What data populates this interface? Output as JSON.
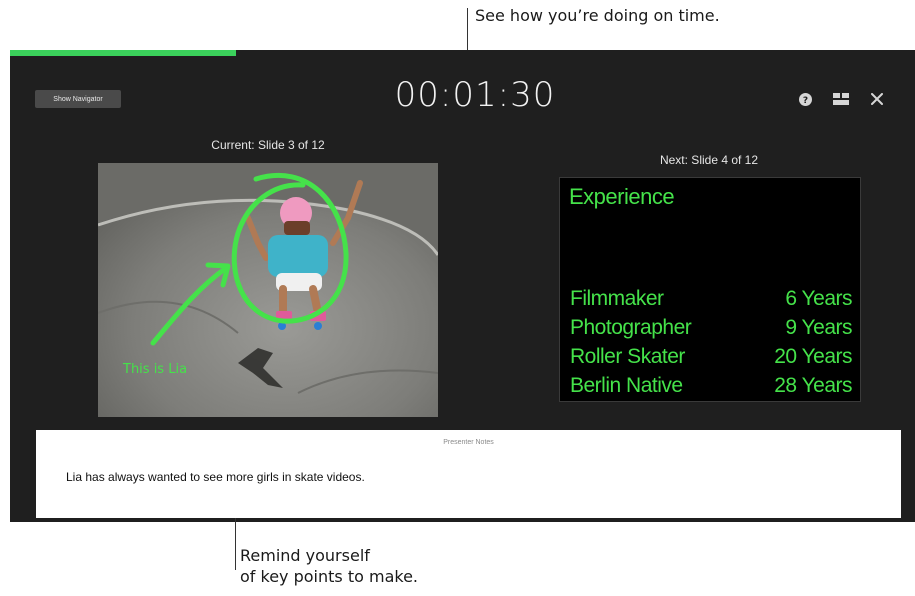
{
  "callouts": {
    "timer_tip": "See how you’re doing on time.",
    "notes_tip_line1": "Remind yourself",
    "notes_tip_line2": "of key points to make."
  },
  "toolbar": {
    "show_navigator_label": "Show Navigator",
    "elapsed_time": "00:01:30",
    "progress_fraction": 0.25,
    "icons": [
      "help-icon",
      "layout-icon",
      "close-icon"
    ]
  },
  "current": {
    "label": "Current: Slide 3 of 12",
    "annotation_text": "This is Lia"
  },
  "next": {
    "label": "Next: Slide 4 of 12",
    "title": "Experience",
    "rows": [
      {
        "role": "Filmmaker",
        "years": "6 Years"
      },
      {
        "role": "Photographer",
        "years": "9 Years"
      },
      {
        "role": "Roller Skater",
        "years": "20 Years"
      },
      {
        "role": "Berlin Native",
        "years": "28 Years"
      }
    ]
  },
  "notes": {
    "header": "Presenter Notes",
    "text": "Lia has always wanted to see more girls in skate videos."
  },
  "colors": {
    "accent_green": "#3bd15b",
    "slide_text_green": "#45e24a",
    "window_bg": "#1f1f1f"
  }
}
